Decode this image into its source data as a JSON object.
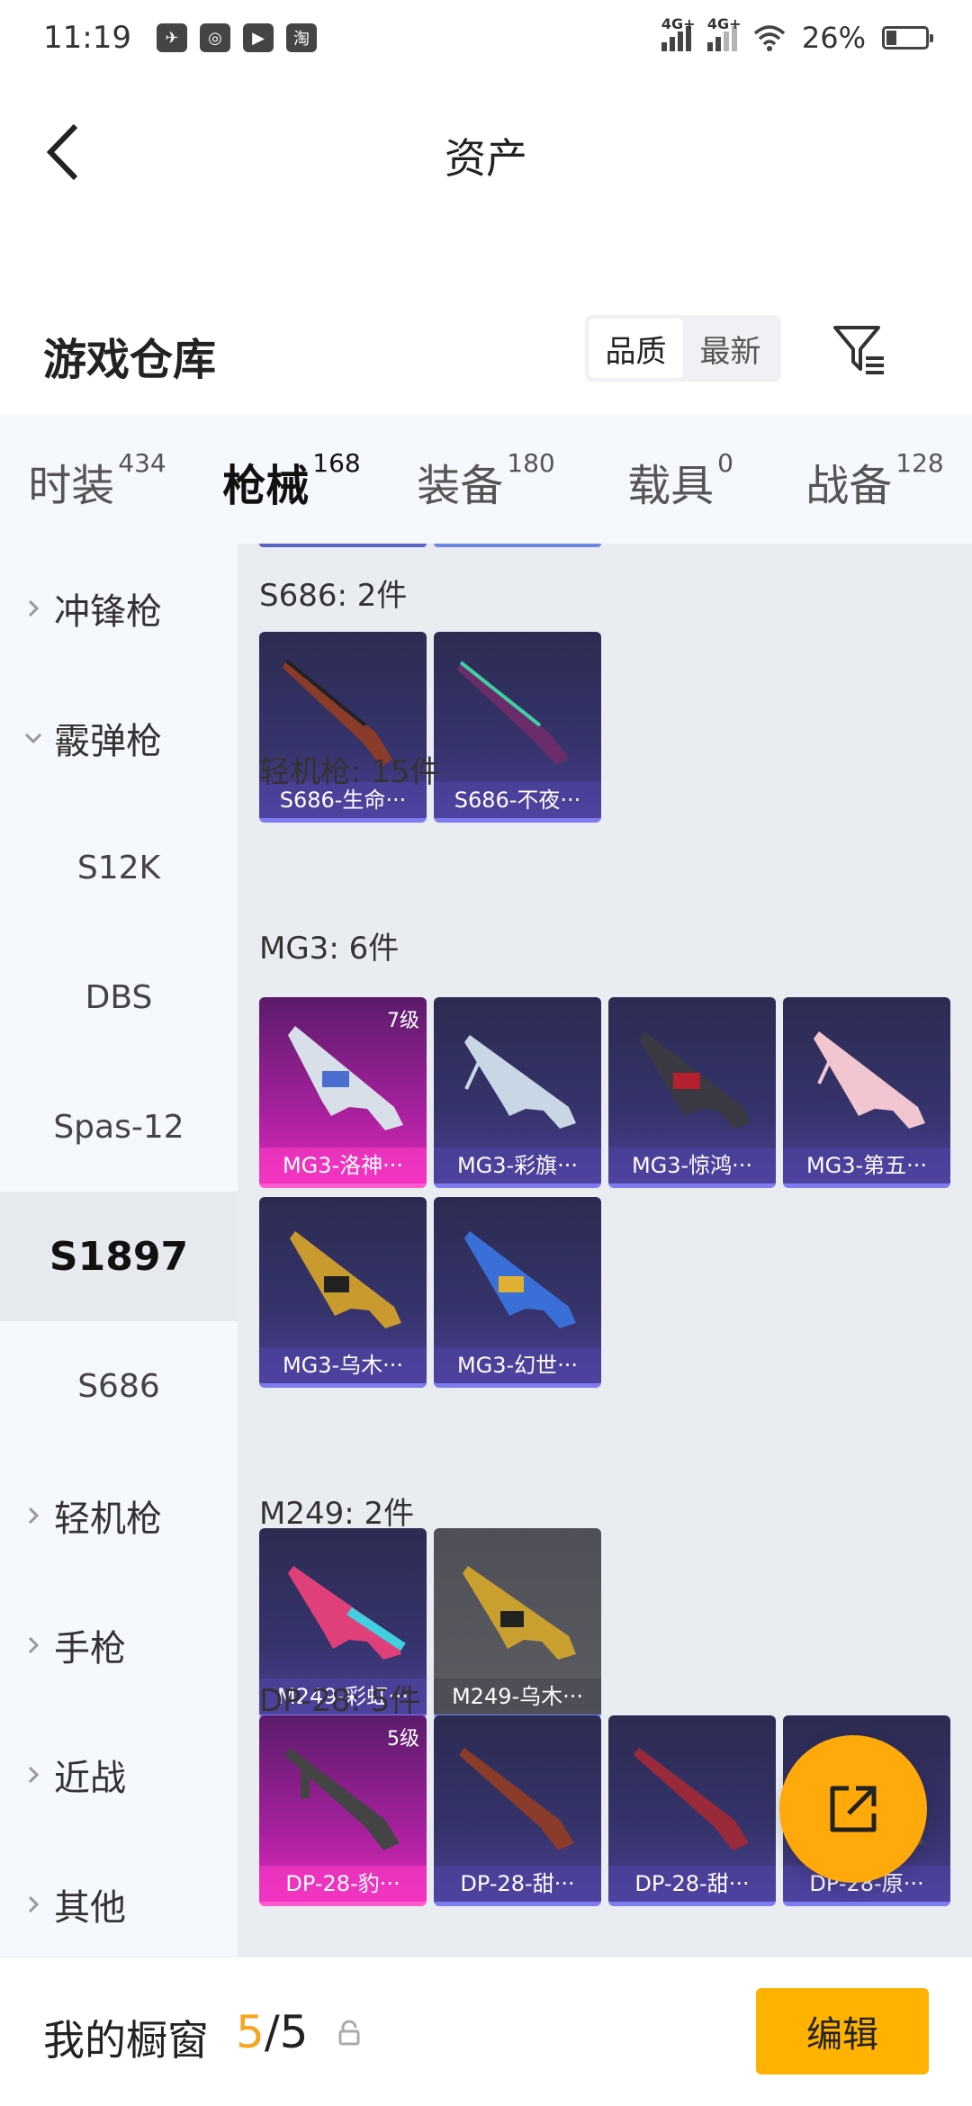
{
  "status_bar": {
    "time": "11:19",
    "battery_text": "26%",
    "battery_level": 0.26,
    "net1": "4G+",
    "net2": "4G+",
    "icons": [
      "bird-icon",
      "uc-browser-icon",
      "video-play-icon",
      "taobao-icon"
    ]
  },
  "header": {
    "title": "资产"
  },
  "warehouse": {
    "title": "游戏仓库",
    "sort_options": [
      "品质",
      "最新"
    ],
    "sort_selected": "品质"
  },
  "tabs": [
    {
      "label": "时装",
      "count": "434"
    },
    {
      "label": "枪械",
      "count": "168",
      "active": true
    },
    {
      "label": "装备",
      "count": "180"
    },
    {
      "label": "载具",
      "count": "0"
    },
    {
      "label": "战备",
      "count": "128"
    }
  ],
  "sidebar": [
    {
      "label": "冲锋枪",
      "type": "category",
      "expanded": false
    },
    {
      "label": "霰弹枪",
      "type": "category",
      "expanded": true
    },
    {
      "label": "S12K",
      "type": "sub"
    },
    {
      "label": "DBS",
      "type": "sub"
    },
    {
      "label": "Spas-12",
      "type": "sub"
    },
    {
      "label": "S1897",
      "type": "sub",
      "selected": true
    },
    {
      "label": "S686",
      "type": "sub"
    },
    {
      "label": "轻机枪",
      "type": "category",
      "expanded": false
    },
    {
      "label": "手枪",
      "type": "category",
      "expanded": false
    },
    {
      "label": "近战",
      "type": "category",
      "expanded": false
    },
    {
      "label": "其他",
      "type": "category",
      "expanded": false
    }
  ],
  "content": {
    "s686_title": "S686: 2件",
    "lmg_title": "轻机枪: 15件",
    "mg3_title": "MG3: 6件",
    "m249_title": "M249: 2件",
    "dp28_title": "DP-28: 5件",
    "s686_items": [
      {
        "name": "S686-生命···",
        "rarity": "purple"
      },
      {
        "name": "S686-不夜···",
        "rarity": "purple"
      }
    ],
    "mg3_items": [
      {
        "name": "MG3-洛神···",
        "rarity": "pink",
        "level": "7级"
      },
      {
        "name": "MG3-彩旗···",
        "rarity": "purple"
      },
      {
        "name": "MG3-惊鸿···",
        "rarity": "purple"
      },
      {
        "name": "MG3-第五···",
        "rarity": "purple"
      },
      {
        "name": "MG3-乌木···",
        "rarity": "purple"
      },
      {
        "name": "MG3-幻世···",
        "rarity": "purple"
      }
    ],
    "m249_items": [
      {
        "name": "M249-彩虹···",
        "rarity": "purple"
      },
      {
        "name": "M249-乌木···",
        "rarity": "grey"
      }
    ],
    "dp28_items": [
      {
        "name": "DP-28-豹···",
        "rarity": "pink",
        "level": "5级"
      },
      {
        "name": "DP-28-甜···",
        "rarity": "purple"
      },
      {
        "name": "DP-28-甜···",
        "rarity": "purple"
      },
      {
        "name": "DP-28-原···",
        "rarity": "purple"
      }
    ]
  },
  "bottom": {
    "showcase_label": "我的橱窗",
    "showcase_current": "5",
    "showcase_sep": "/",
    "showcase_total": "5",
    "edit_label": "编辑"
  },
  "colors": {
    "accent": "#ffb300",
    "fab": "#ffa90a",
    "rarity_purple": "#4b3f93",
    "rarity_pink": "#e02ab8",
    "rarity_grey": "#5c5c63"
  }
}
